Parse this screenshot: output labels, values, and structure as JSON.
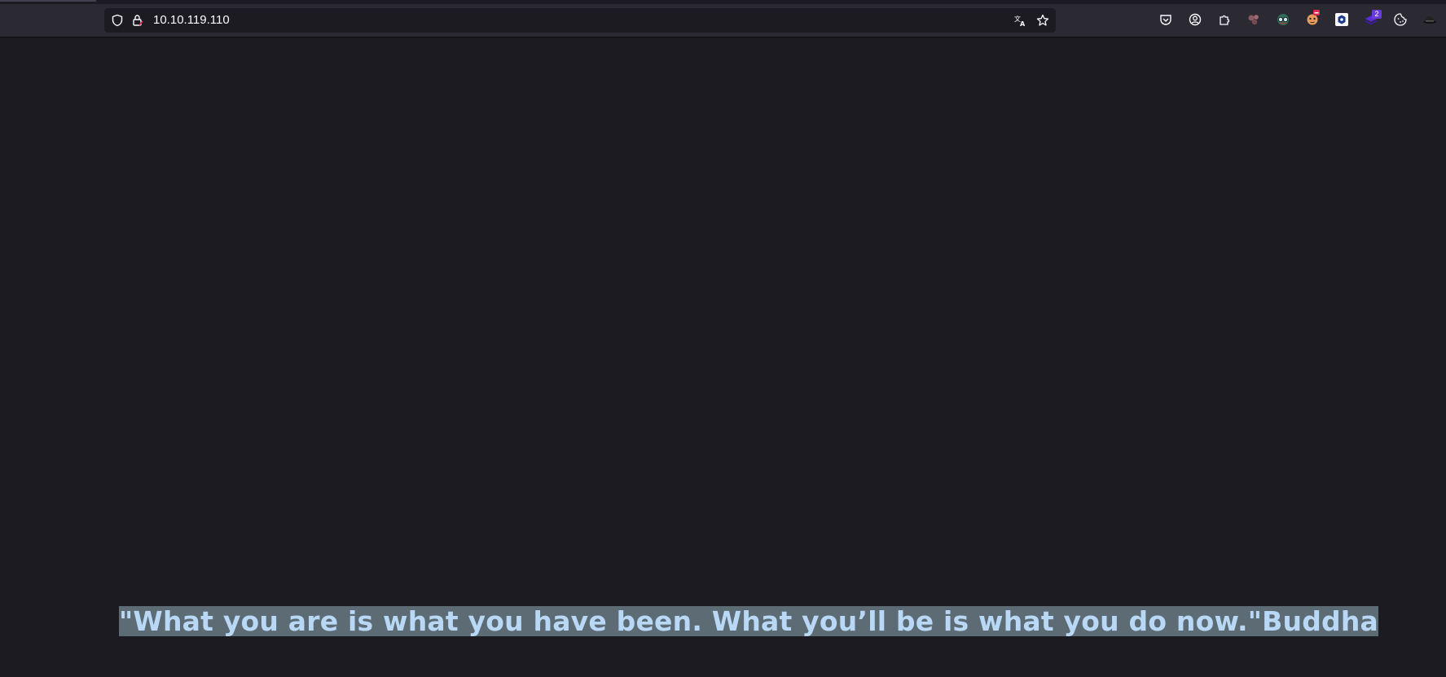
{
  "browser": {
    "url": "10.10.119.110",
    "extension_badge_count": "2"
  },
  "icons": {
    "tracking_protection": "shield-icon",
    "site_info": "lock-icon",
    "translate": "translate-icon",
    "bookmark": "star-icon",
    "pocket": "pocket-icon",
    "account": "account-icon",
    "extensions": "puzzle-icon"
  },
  "page": {
    "quote": "\"What you are is what you have been. What you’ll be is what you do now.\"Buddha"
  },
  "colors": {
    "background": "#1c1b22",
    "toolbar": "#2b2a33",
    "quote_text": "#b8d8f5",
    "selection": "#5d6b75"
  }
}
